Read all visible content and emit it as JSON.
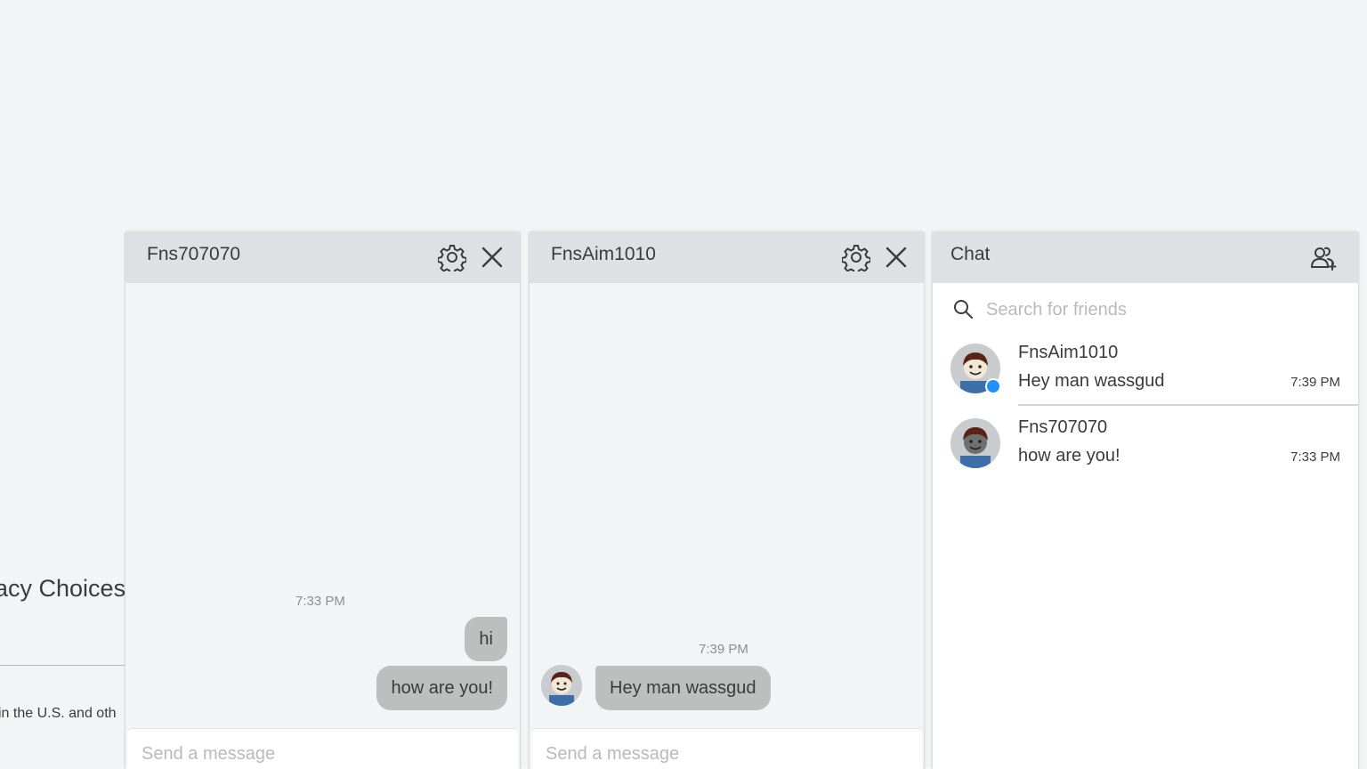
{
  "background": {
    "privacy_fragment": "acy Choices",
    "legal_fragment": "in the U.S. and oth"
  },
  "conversations": [
    {
      "title": "Fns707070",
      "timestamp": "7:33 PM",
      "messages": [
        {
          "text": "hi",
          "from": "me"
        },
        {
          "text": "how are you!",
          "from": "me"
        }
      ],
      "input_placeholder": "Send a message"
    },
    {
      "title": "FnsAim1010",
      "timestamp": "7:39 PM",
      "messages": [
        {
          "text": "Hey man wassgud",
          "from": "friend"
        }
      ],
      "input_placeholder": "Send a message"
    }
  ],
  "chat_list": {
    "title": "Chat",
    "search_placeholder": "Search for friends",
    "friends": [
      {
        "name": "FnsAim1010",
        "preview": "Hey man wassgud",
        "time": "7:39 PM",
        "online": true
      },
      {
        "name": "Fns707070",
        "preview": "how are you!",
        "time": "7:33 PM",
        "online": false
      }
    ]
  },
  "icons": {
    "settings": "gear-icon",
    "close": "close-icon",
    "search": "search-icon",
    "add_friends": "add-friends-icon"
  },
  "colors": {
    "header_bg": "#dee1e3",
    "bubble_bg": "#bdbebe",
    "online_dot": "#1e90ff",
    "page_bg": "#f2f4f5"
  }
}
